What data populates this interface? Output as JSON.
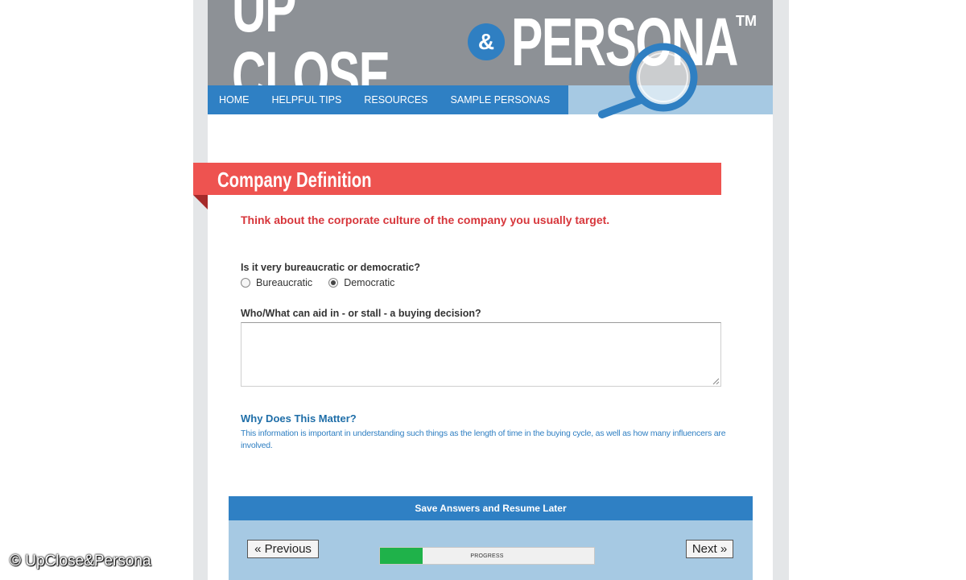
{
  "header": {
    "logo_word_1": "UP CLOSE",
    "logo_amp": "&",
    "logo_word_2": "PERSONA",
    "logo_tm": "TM",
    "accent_color": "#2f7fc2"
  },
  "nav": {
    "items": [
      {
        "label": "HOME"
      },
      {
        "label": "HELPFUL TIPS"
      },
      {
        "label": "RESOURCES"
      },
      {
        "label": "SAMPLE PERSONAS"
      }
    ]
  },
  "section": {
    "title": "Company Definition",
    "intro": "Think about the corporate culture of the company you usually target.",
    "banner_color": "#ee5350"
  },
  "questions": {
    "q1": {
      "label": "Is it very bureaucratic or democratic?",
      "options": [
        {
          "label": "Bureaucratic",
          "checked": false
        },
        {
          "label": "Democratic",
          "checked": true
        }
      ]
    },
    "q2": {
      "label": "Who/What can aid in - or stall - a buying decision?",
      "value": ""
    }
  },
  "why": {
    "title": "Why Does This Matter?",
    "text": "This information is important in understanding such things as the length of time in the buying cycle, as well as how many influencers are involved."
  },
  "footer": {
    "save_label": "Save Answers and Resume Later",
    "prev_label": "« Previous",
    "next_label": "Next »",
    "progress_label": "PROGRESS",
    "progress_fraction": 0.2
  },
  "copyright": "© UpClose&Persona"
}
